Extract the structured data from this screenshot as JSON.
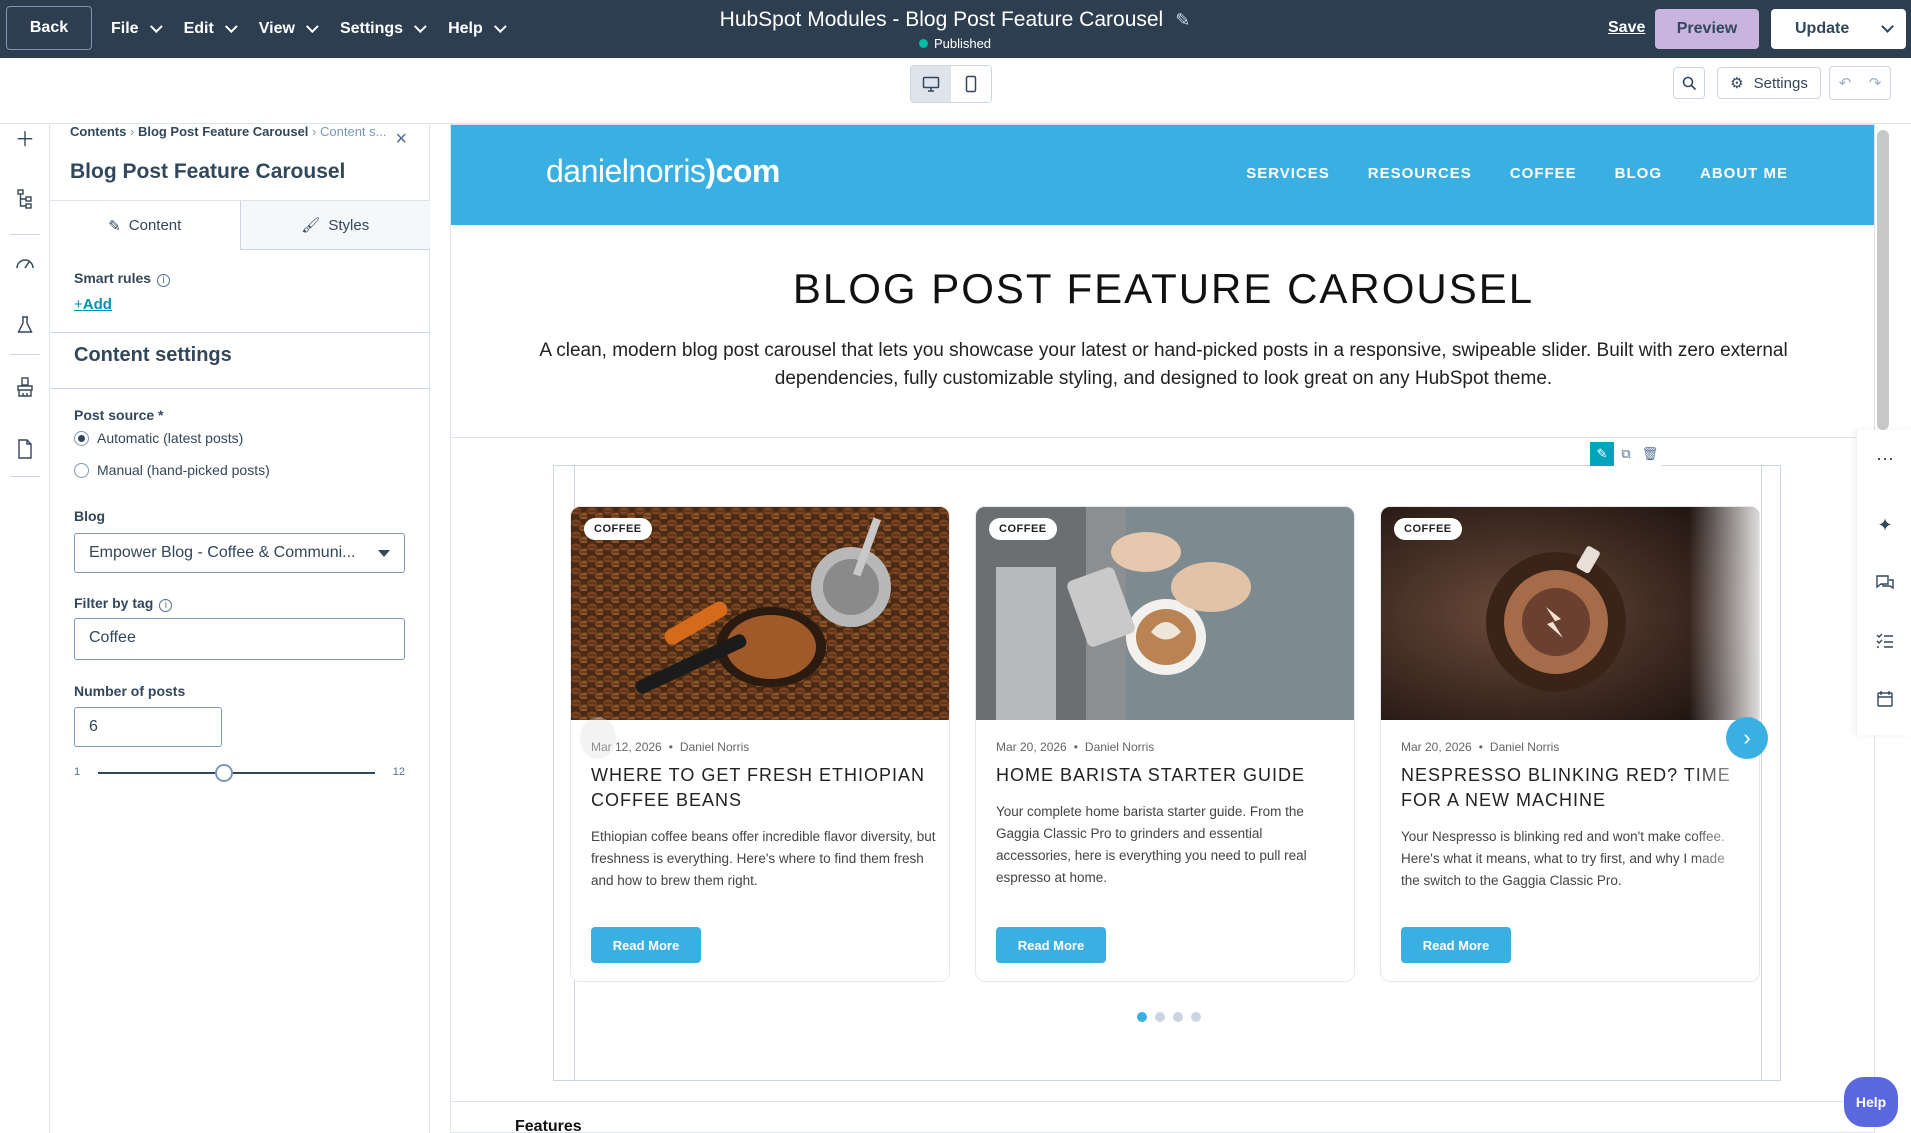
{
  "topbar": {
    "back_label": "Back",
    "menus": [
      {
        "label": "File"
      },
      {
        "label": "Edit"
      },
      {
        "label": "View"
      },
      {
        "label": "Settings"
      },
      {
        "label": "Help"
      }
    ],
    "title": "HubSpot Modules - Blog Post Feature Carousel",
    "status": "Published",
    "save_label": "Save",
    "preview_label": "Preview",
    "update_label": "Update"
  },
  "toolbar": {
    "settings_label": "Settings"
  },
  "panel": {
    "breadcrumb": {
      "root": "Contents",
      "middle": "Blog Post Feature Carousel",
      "current": "Content s..."
    },
    "title": "Blog Post Feature Carousel",
    "tabs": [
      {
        "label": "Content"
      },
      {
        "label": "Styles"
      }
    ],
    "smart_rules_label": "Smart rules",
    "add_label": "Add",
    "content_settings_title": "Content settings",
    "post_source_label": "Post source *",
    "post_source_options": [
      {
        "label": "Automatic (latest posts)",
        "selected": true
      },
      {
        "label": "Manual (hand-picked posts)",
        "selected": false
      }
    ],
    "blog_label": "Blog",
    "blog_value": "Empower Blog - Coffee & Communi...",
    "filter_label": "Filter by tag",
    "filter_value": "Coffee",
    "num_posts_label": "Number of posts",
    "num_posts_value": "6",
    "slider_min": "1",
    "slider_max": "12"
  },
  "site": {
    "logo_text": "danielnorris",
    "logo_suffix": "com",
    "nav": [
      "SERVICES",
      "RESOURCES",
      "COFFEE",
      "BLOG",
      "ABOUT ME"
    ],
    "hero_title": "BLOG POST FEATURE CAROUSEL",
    "hero_desc": "A clean, modern blog post carousel that lets you showcase your latest or hand-picked posts in a responsive, swipeable slider. Built with zero external dependencies, fully customizable styling, and designed to look great on any HubSpot theme.",
    "features_heading": "Features",
    "accent_color": "#3ab0e2"
  },
  "cards": [
    {
      "badge": "COFFEE",
      "date": "Mar 12, 2026",
      "author": "Daniel Norris",
      "title": "WHERE TO GET FRESH ETHIOPIAN COFFEE BEANS",
      "excerpt": "Ethiopian coffee beans offer incredible flavor diversity, but freshness is everything. Here's where to find them fresh and how to brew them right.",
      "cta": "Read More"
    },
    {
      "badge": "COFFEE",
      "date": "Mar 20, 2026",
      "author": "Daniel Norris",
      "title": "HOME BARISTA STARTER GUIDE",
      "excerpt": "Your complete home barista starter guide. From the Gaggia Classic Pro to grinders and essential accessories, here is everything you need to pull real espresso at home.",
      "cta": "Read More"
    },
    {
      "badge": "COFFEE",
      "date": "Mar 20, 2026",
      "author": "Daniel Norris",
      "title": "NESPRESSO BLINKING RED? TIME FOR A NEW MACHINE",
      "excerpt": "Your Nespresso is blinking red and won't make coffee. Here's what it means, what to try first, and why I made the switch to the Gaggia Classic Pro.",
      "cta": "Read More"
    }
  ],
  "carousel": {
    "pages": 4,
    "active_page": 1
  },
  "help_label": "Help"
}
